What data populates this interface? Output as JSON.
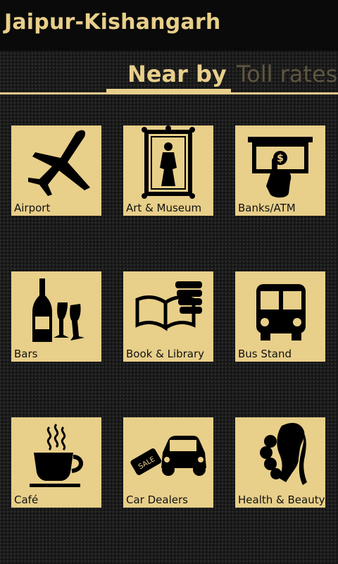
{
  "app": {
    "title": "Jaipur-Kishangarh"
  },
  "tabs": {
    "near_by": "Near by",
    "toll_rates": "Toll rates",
    "active": "near_by"
  },
  "colors": {
    "accent": "#e8cf8a",
    "tile_background": "#e8cf8a",
    "inactive_tab": "#5e5640",
    "background": "#1c1c1c"
  },
  "tiles": [
    {
      "label": "Airport",
      "icon": "airplane-icon"
    },
    {
      "label": "Art & Museum",
      "icon": "framed-portrait-icon"
    },
    {
      "label": "Banks/ATM",
      "icon": "atm-hand-icon"
    },
    {
      "label": "Bars",
      "icon": "bottle-glasses-icon"
    },
    {
      "label": "Book & Library",
      "icon": "books-icon"
    },
    {
      "label": "Bus Stand",
      "icon": "bus-icon"
    },
    {
      "label": "Café",
      "icon": "coffee-cup-icon"
    },
    {
      "label": "Car Dealers",
      "icon": "car-sale-tag-icon"
    },
    {
      "label": "Health & Beauty",
      "icon": "face-profile-icon"
    }
  ]
}
